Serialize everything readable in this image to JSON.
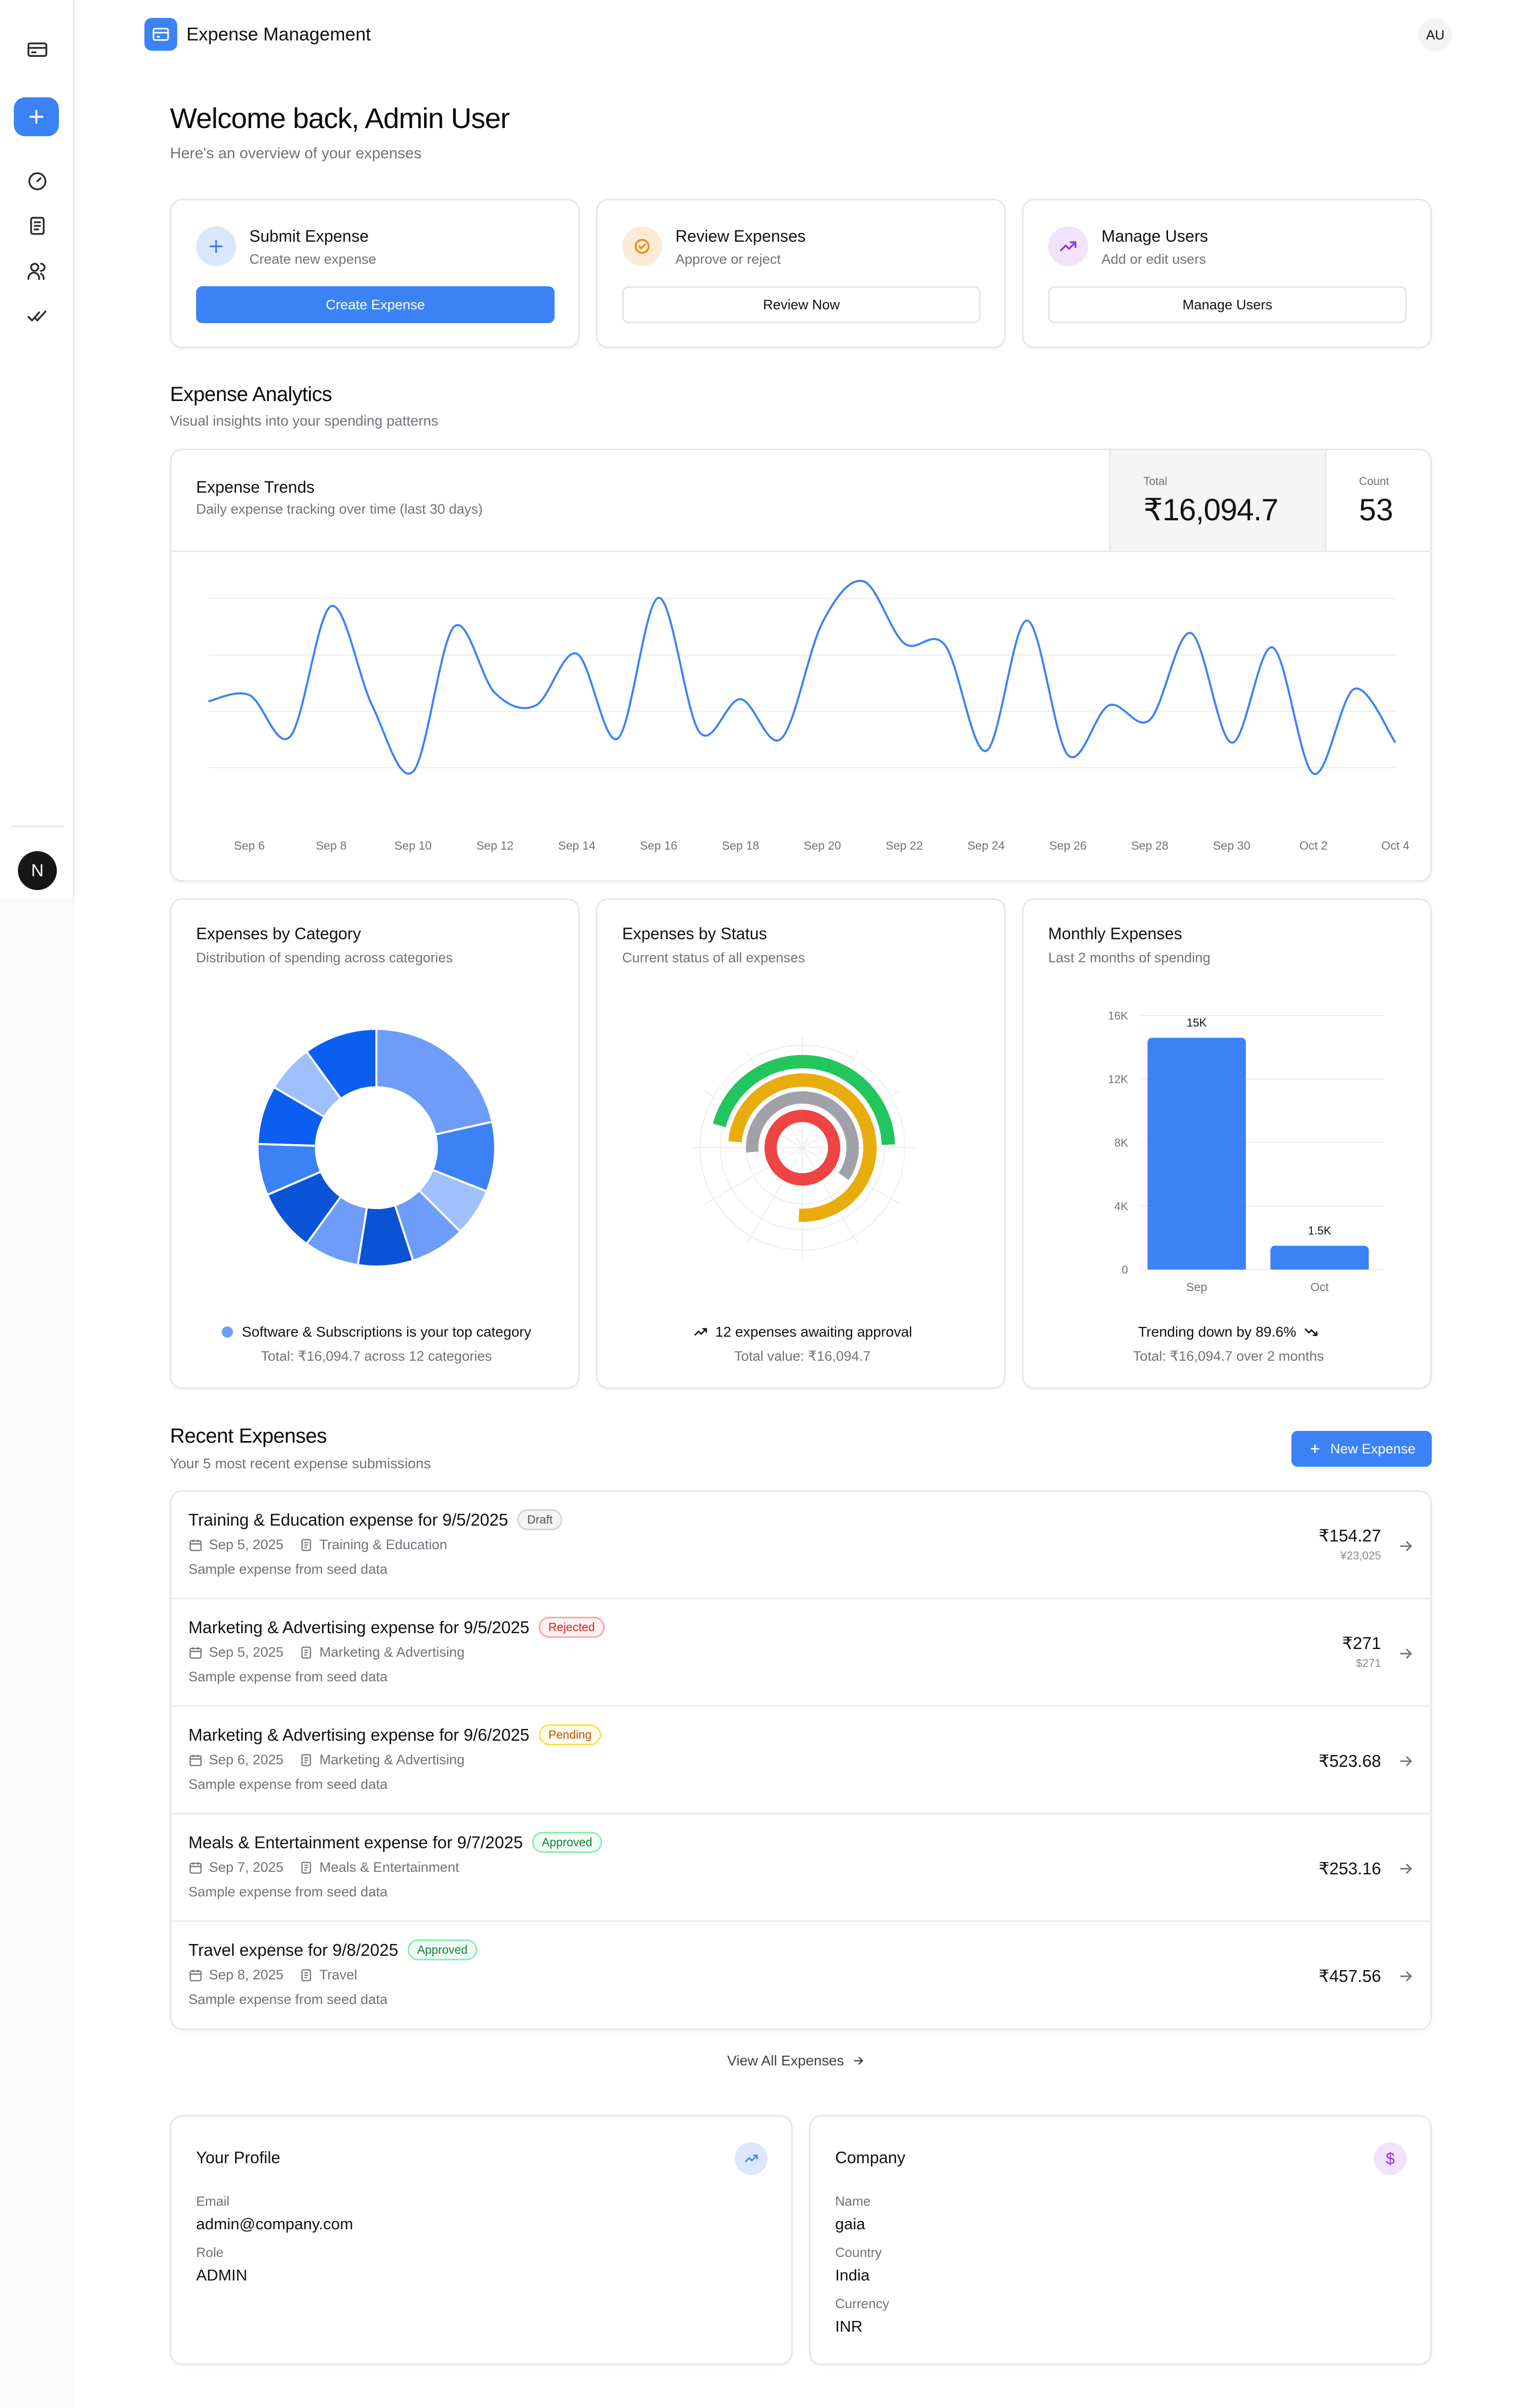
{
  "app": {
    "title": "Expense Management",
    "user_initials": "AU",
    "footer_avatar_letter": "N"
  },
  "sidebar": {
    "items": [
      "credit-card-icon",
      "plus-icon",
      "gauge-icon",
      "receipt-icon",
      "users-icon",
      "check-check-icon"
    ]
  },
  "welcome": {
    "title": "Welcome back, Admin User",
    "subtitle": "Here's an overview of your expenses"
  },
  "quick_actions": [
    {
      "title": "Submit Expense",
      "subtitle": "Create new expense",
      "button": "Create Expense",
      "icon": "plus-icon",
      "color": "#3b82f6",
      "bg": "#dbe7fd"
    },
    {
      "title": "Review Expenses",
      "subtitle": "Approve or reject",
      "button": "Review Now",
      "icon": "check-circle-icon",
      "color": "#ea8a15",
      "bg": "#fdebd5"
    },
    {
      "title": "Manage Users",
      "subtitle": "Add or edit users",
      "button": "Manage Users",
      "icon": "trending-up-icon",
      "color": "#9333ea",
      "bg": "#f1e3fd"
    }
  ],
  "analytics": {
    "title": "Expense Analytics",
    "subtitle": "Visual insights into your spending patterns"
  },
  "trends": {
    "title": "Expense Trends",
    "subtitle": "Daily expense tracking over time (last 30 days)",
    "total_label": "Total",
    "total_value": "₹16,094.7",
    "count_label": "Count",
    "count_value": "53"
  },
  "category_card": {
    "title": "Expenses by Category",
    "subtitle": "Distribution of spending across categories",
    "top_line": "Software & Subscriptions is your top category",
    "total_line": "Total: ₹16,094.7 across 12 categories"
  },
  "status_card": {
    "title": "Expenses by Status",
    "subtitle": "Current status of all expenses",
    "top_line": "12 expenses awaiting approval",
    "total_line": "Total value: ₹16,094.7"
  },
  "monthly_card": {
    "title": "Monthly Expenses",
    "subtitle": "Last 2 months of spending",
    "top_line": "Trending down by 89.6%",
    "total_line": "Total: ₹16,094.7 over 2 months"
  },
  "chart_data": [
    {
      "type": "line",
      "title": "Expense Trends",
      "x_tick_labels": [
        "Sep 6",
        "Sep 8",
        "Sep 10",
        "Sep 12",
        "Sep 14",
        "Sep 16",
        "Sep 18",
        "Sep 20",
        "Sep 22",
        "Sep 24",
        "Sep 26",
        "Sep 28",
        "Sep 30",
        "Oct 2",
        "Oct 4"
      ],
      "x": [
        "Sep 5",
        "Sep 6",
        "Sep 7",
        "Sep 8",
        "Sep 9",
        "Sep 10",
        "Sep 11",
        "Sep 12",
        "Sep 13",
        "Sep 14",
        "Sep 15",
        "Sep 16",
        "Sep 17",
        "Sep 18",
        "Sep 19",
        "Sep 20",
        "Sep 21",
        "Sep 22",
        "Sep 23",
        "Sep 24",
        "Sep 25",
        "Sep 26",
        "Sep 27",
        "Sep 28",
        "Sep 29",
        "Sep 30",
        "Oct 1",
        "Oct 2",
        "Oct 3",
        "Oct 4"
      ],
      "values": [
        0.42,
        0.45,
        0.25,
        0.88,
        0.4,
        0.08,
        0.78,
        0.46,
        0.4,
        0.65,
        0.24,
        0.92,
        0.27,
        0.43,
        0.24,
        0.8,
        1.0,
        0.7,
        0.69,
        0.18,
        0.81,
        0.16,
        0.4,
        0.33,
        0.75,
        0.22,
        0.68,
        0.07,
        0.48,
        0.22
      ],
      "grid": true,
      "color": "#3b82f6"
    },
    {
      "type": "pie",
      "title": "Expenses by Category",
      "values": [
        21.5,
        9.5,
        6.5,
        7.5,
        7.5,
        7.5,
        8.5,
        7.0,
        8.0,
        6.5,
        10.0
      ],
      "colors": [
        "#6d9df8",
        "#3b82f6",
        "#9fc0fb",
        "#6d9df8",
        "#0a53d6",
        "#6d9df8",
        "#0a53d6",
        "#3b82f6",
        "#0b5ef0",
        "#9fc0fb",
        "#0b5ef0"
      ]
    },
    {
      "type": "bar",
      "title": "Expenses by Status",
      "series": [
        {
          "value": 0.1,
          "color": "#22c55e"
        },
        {
          "value": 0.12,
          "color": "#e8ad0c"
        },
        {
          "value": 0.15,
          "color": "#a1a1aa"
        },
        {
          "value": 0.12,
          "color": "#ef4444"
        }
      ]
    },
    {
      "type": "bar",
      "title": "Monthly Expenses",
      "categories": [
        "Sep",
        "Oct"
      ],
      "values": [
        14600,
        1500
      ],
      "data_labels": [
        "15K",
        "1.5K"
      ],
      "y_tick_labels": [
        "0",
        "4K",
        "8K",
        "12K",
        "16K"
      ],
      "ylim": [
        0,
        16000
      ],
      "color": "#3b82f6"
    }
  ],
  "recent": {
    "title": "Recent Expenses",
    "subtitle": "Your 5 most recent expense submissions",
    "new_button": "New Expense",
    "view_all": "View All Expenses",
    "items": [
      {
        "title": "Training & Education expense for 9/5/2025",
        "status": "Draft",
        "date": "Sep 5, 2025",
        "category": "Training & Education",
        "desc": "Sample expense from seed data",
        "amount": "₹154.27",
        "sub": "¥23,025"
      },
      {
        "title": "Marketing & Advertising expense for 9/5/2025",
        "status": "Rejected",
        "date": "Sep 5, 2025",
        "category": "Marketing & Advertising",
        "desc": "Sample expense from seed data",
        "amount": "₹271",
        "sub": "$271"
      },
      {
        "title": "Marketing & Advertising expense for 9/6/2025",
        "status": "Pending",
        "date": "Sep 6, 2025",
        "category": "Marketing & Advertising",
        "desc": "Sample expense from seed data",
        "amount": "₹523.68",
        "sub": ""
      },
      {
        "title": "Meals & Entertainment expense for 9/7/2025",
        "status": "Approved",
        "date": "Sep 7, 2025",
        "category": "Meals & Entertainment",
        "desc": "Sample expense from seed data",
        "amount": "₹253.16",
        "sub": ""
      },
      {
        "title": "Travel expense for 9/8/2025",
        "status": "Approved",
        "date": "Sep 8, 2025",
        "category": "Travel",
        "desc": "Sample expense from seed data",
        "amount": "₹457.56",
        "sub": ""
      }
    ]
  },
  "status_styles": {
    "Draft": {
      "color": "#52525b",
      "bg": "#f4f4f5",
      "border": "#d4d4d8"
    },
    "Rejected": {
      "color": "#dc2626",
      "bg": "#fef2f2",
      "border": "#fca5a5"
    },
    "Pending": {
      "color": "#b45309",
      "bg": "#fefce8",
      "border": "#fde047"
    },
    "Approved": {
      "color": "#15803d",
      "bg": "#f0fdf4",
      "border": "#86efac"
    }
  },
  "profile": {
    "title": "Your Profile",
    "email_label": "Email",
    "email": "admin@company.com",
    "role_label": "Role",
    "role": "ADMIN"
  },
  "company": {
    "title": "Company",
    "name_label": "Name",
    "name": "gaia",
    "country_label": "Country",
    "country": "India",
    "currency_label": "Currency",
    "currency": "INR"
  }
}
